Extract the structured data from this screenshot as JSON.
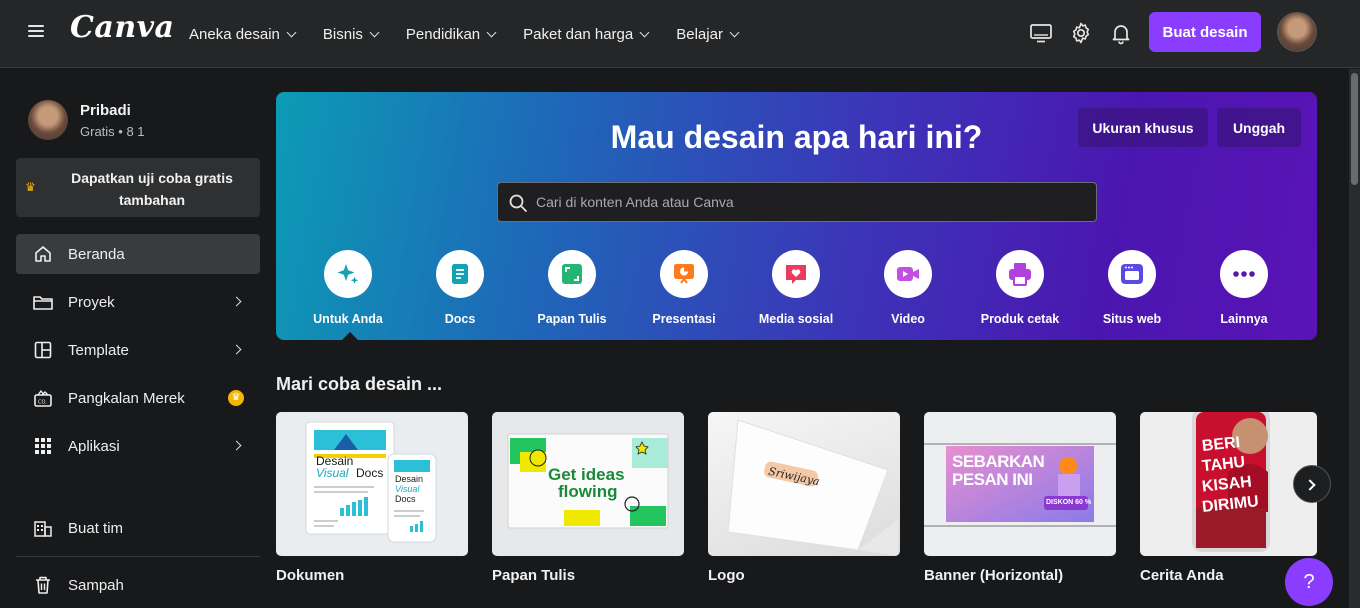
{
  "app": {
    "logo": "Canva"
  },
  "topnav": {
    "items": [
      {
        "label": "Aneka desain"
      },
      {
        "label": "Bisnis"
      },
      {
        "label": "Pendidikan"
      },
      {
        "label": "Paket dan harga"
      },
      {
        "label": "Belajar"
      }
    ],
    "create_button": "Buat desain",
    "icons": [
      "monitor-icon",
      "gear-icon",
      "bell-icon"
    ]
  },
  "sidebar": {
    "profile": {
      "name": "Pribadi",
      "sub": "Gratis • 8 1"
    },
    "trial": "Dapatkan uji coba gratis tambahan",
    "items": [
      {
        "label": "Beranda",
        "icon": "home-icon",
        "active": true
      },
      {
        "label": "Proyek",
        "icon": "folder-icon"
      },
      {
        "label": "Template",
        "icon": "template-icon"
      },
      {
        "label": "Pangkalan Merek",
        "icon": "brand-kit-icon"
      },
      {
        "label": "Aplikasi",
        "icon": "apps-icon"
      },
      {
        "label": "Buat tim",
        "icon": "team-icon"
      },
      {
        "label": "Sampah",
        "icon": "trash-icon"
      }
    ]
  },
  "hero": {
    "title": "Mau desain apa hari ini?",
    "custom_size": "Ukuran khusus",
    "upload": "Unggah",
    "search_placeholder": "Cari di konten Anda atau Canva",
    "categories": [
      {
        "label": "Untuk Anda",
        "icon": "sparkle-icon",
        "color": "#13a3b5"
      },
      {
        "label": "Docs",
        "icon": "doc-icon",
        "color": "#13a3b5"
      },
      {
        "label": "Papan Tulis",
        "icon": "whiteboard-icon",
        "color": "#22b573"
      },
      {
        "label": "Presentasi",
        "icon": "presentation-icon",
        "color": "#ff7a1a"
      },
      {
        "label": "Media sosial",
        "icon": "heart-icon",
        "color": "#ef3a5d"
      },
      {
        "label": "Video",
        "icon": "video-icon",
        "color": "#c24fe0"
      },
      {
        "label": "Produk cetak",
        "icon": "print-icon",
        "color": "#b140e0"
      },
      {
        "label": "Situs web",
        "icon": "website-icon",
        "color": "#5b4be6"
      },
      {
        "label": "Lainnya",
        "icon": "more-icon",
        "color": "#5a1aa8"
      }
    ]
  },
  "section": {
    "title": "Mari coba desain ...",
    "cards": [
      {
        "label": "Dokumen",
        "thumb_text_1": "Desain",
        "thumb_text_2": "Visual",
        "thumb_text_3": "Docs"
      },
      {
        "label": "Papan Tulis",
        "thumb_text_1": "Get ideas",
        "thumb_text_2": "flowing"
      },
      {
        "label": "Logo",
        "thumb_text_1": "Sriwijaya"
      },
      {
        "label": "Banner (Horizontal)",
        "thumb_text_1": "SEBARKAN",
        "thumb_text_2": "PESAN INI",
        "thumb_text_3": "DISKON 60 %"
      },
      {
        "label": "Cerita Anda",
        "thumb_text_1": "BERI",
        "thumb_text_2": "TAHU",
        "thumb_text_3": "KISAH",
        "thumb_text_4": "DIRIMU"
      }
    ]
  },
  "help": "?"
}
